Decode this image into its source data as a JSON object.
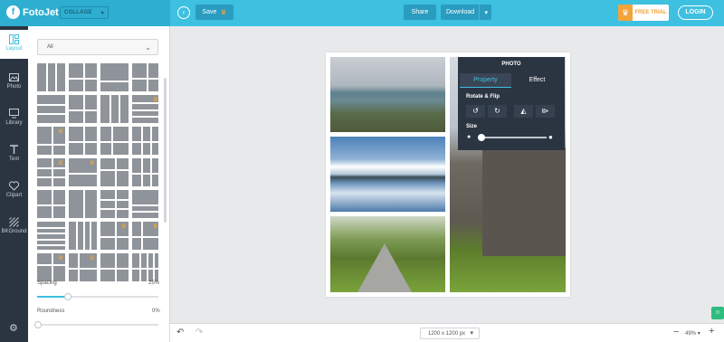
{
  "app": {
    "logo_text": "FotoJet",
    "mode_label": "COLLAGE"
  },
  "toolbar": {
    "save_label": "Save",
    "share_label": "Share",
    "download_label": "Download",
    "trial_label": "FREE TRIAL",
    "login_label": "LOGIN"
  },
  "sidebar": {
    "items": [
      {
        "label": "Layout",
        "icon": "layout-icon"
      },
      {
        "label": "Photo",
        "icon": "photo-icon"
      },
      {
        "label": "Library",
        "icon": "library-icon"
      },
      {
        "label": "Text",
        "icon": "text-icon"
      },
      {
        "label": "Clipart",
        "icon": "clipart-icon"
      },
      {
        "label": "BKGround",
        "icon": "background-icon"
      }
    ],
    "settings_icon": "gear-icon"
  },
  "layout_panel": {
    "filter_value": "All",
    "spacing_label": "Spacing",
    "spacing_value": "25%",
    "spacing_level": 0.25,
    "roundness_label": "Roundness",
    "roundness_value": "0%",
    "roundness_level": 0
  },
  "photo_panel": {
    "title": "PHOTO",
    "tabs": [
      "Property",
      "Effect"
    ],
    "rotate_label": "Rotate & Flip",
    "size_label": "Size"
  },
  "bottombar": {
    "dimension_value": "1200 x 1200 px",
    "zoom_value": "49%"
  },
  "colors": {
    "accent": "#3ec0e0",
    "premium": "#f2a33a",
    "dark": "#2b3542"
  }
}
